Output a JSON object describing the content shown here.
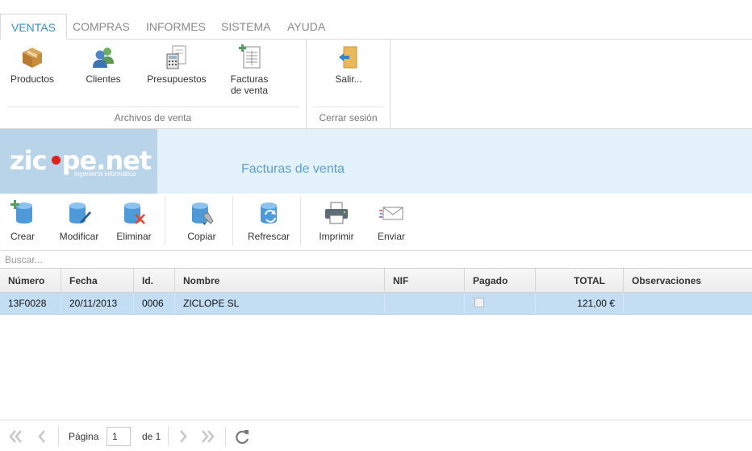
{
  "menu": {
    "tabs": [
      {
        "label": "VENTAS",
        "active": true
      },
      {
        "label": "COMPRAS"
      },
      {
        "label": "INFORMES"
      },
      {
        "label": "SISTEMA"
      },
      {
        "label": "AYUDA"
      }
    ]
  },
  "ribbon": {
    "groups": [
      {
        "label": "Archivos de venta",
        "buttons": [
          {
            "label": "Productos",
            "icon": "box-icon"
          },
          {
            "label": "Clientes",
            "icon": "users-icon"
          },
          {
            "label": "Presupuestos",
            "icon": "calculator-icon"
          },
          {
            "label": "Facturas de venta",
            "line1": "Facturas",
            "line2": "de venta",
            "icon": "invoice-add-icon"
          }
        ]
      },
      {
        "label": "Cerrar sesión",
        "buttons": [
          {
            "label": "Salir...",
            "icon": "exit-door-icon"
          }
        ]
      }
    ]
  },
  "banner": {
    "logo_text": "zic",
    "logo_text2": "pe.net",
    "logo_sub": "ingeniería informática",
    "title": "Facturas de venta"
  },
  "toolbar": {
    "buttons": [
      {
        "label": "Crear",
        "icon": "db-add-icon"
      },
      {
        "label": "Modificar",
        "icon": "db-edit-icon"
      },
      {
        "label": "Eliminar",
        "icon": "db-delete-icon"
      },
      {
        "label": "Copiar",
        "icon": "db-copy-icon"
      },
      {
        "label": "Refrescar",
        "icon": "db-refresh-icon"
      },
      {
        "label": "Imprimir",
        "icon": "printer-icon"
      },
      {
        "label": "Enviar",
        "icon": "envelope-icon"
      }
    ]
  },
  "search": {
    "placeholder": "Buscar..."
  },
  "grid": {
    "columns": [
      "Número",
      "Fecha",
      "Id.",
      "Nombre",
      "NIF",
      "Pagado",
      "TOTAL",
      "Observaciones"
    ],
    "rows": [
      {
        "numero": "13F0028",
        "fecha": "20/11/2013",
        "id": "0006",
        "nombre": "ZICLOPE SL",
        "nif": "",
        "pagado": false,
        "total": "121,00 €",
        "observaciones": ""
      }
    ]
  },
  "pager": {
    "page_label": "Página",
    "page_value": "1",
    "of_label": "de 1"
  },
  "colors": {
    "accent": "#3a8fd0",
    "selected_row": "#c3ddf2",
    "banner_bg": "#e3f1fb",
    "logo_red": "#e0201b"
  }
}
